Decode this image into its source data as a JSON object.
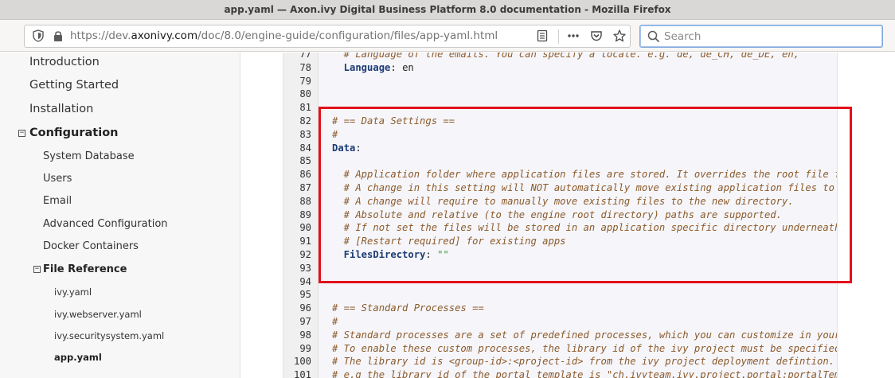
{
  "window": {
    "title": "app.yaml — Axon.ivy Digital Business Platform 8.0 documentation - Mozilla Firefox"
  },
  "browser": {
    "url_scheme": "https://dev.",
    "url_domain": "axonivy.com",
    "url_path": "/doc/8.0/engine-guide/configuration/files/app-yaml.html",
    "search_placeholder": "Search",
    "icons": [
      "shield-icon",
      "lock-icon",
      "reader-view-icon",
      "more-icon",
      "pocket-icon",
      "star-icon",
      "search-icon"
    ]
  },
  "sidebar": {
    "items": [
      {
        "label": "Introduction",
        "level": 1
      },
      {
        "label": "Getting Started",
        "level": 1
      },
      {
        "label": "Installation",
        "level": 1
      },
      {
        "label": "Configuration",
        "level": 1,
        "expanded": true
      },
      {
        "label": "System Database",
        "level": 2
      },
      {
        "label": "Users",
        "level": 2
      },
      {
        "label": "Email",
        "level": 2
      },
      {
        "label": "Advanced Configuration",
        "level": 2
      },
      {
        "label": "Docker Containers",
        "level": 2
      },
      {
        "label": "File Reference",
        "level": 2,
        "expanded": true
      },
      {
        "label": "ivy.yaml",
        "level": 3
      },
      {
        "label": "ivy.webserver.yaml",
        "level": 3
      },
      {
        "label": "ivy.securitysystem.yaml",
        "level": 3
      },
      {
        "label": "app.yaml",
        "level": 3,
        "current": true
      },
      {
        "label": "",
        "level": 3
      }
    ],
    "toggle_symbol": "−"
  },
  "code": {
    "lines": [
      {
        "n": "77",
        "cls": "cm",
        "text": "  # Language of the emails. You can specify a locale. e.g. de, de_CH, de_DE, en,"
      },
      {
        "n": "78",
        "cls": "kv",
        "key": "  Language",
        "sep": ": ",
        "val": "en",
        "valcls": "plain"
      },
      {
        "n": "79",
        "cls": "plain",
        "text": ""
      },
      {
        "n": "80",
        "cls": "plain",
        "text": ""
      },
      {
        "n": "81",
        "cls": "plain",
        "text": ""
      },
      {
        "n": "82",
        "cls": "cm",
        "text": "# == Data Settings =="
      },
      {
        "n": "83",
        "cls": "cm",
        "text": "#"
      },
      {
        "n": "84",
        "cls": "kv",
        "key": "Data",
        "sep": ":",
        "val": "",
        "valcls": "plain"
      },
      {
        "n": "85",
        "cls": "plain",
        "text": ""
      },
      {
        "n": "86",
        "cls": "cm",
        "text": "  # Application folder where application files are stored. It overrides the root file fo"
      },
      {
        "n": "87",
        "cls": "cm",
        "text": "  # A change in this setting will NOT automatically move existing application files to t"
      },
      {
        "n": "88",
        "cls": "cm",
        "text": "  # A change will require to manually move existing files to the new directory."
      },
      {
        "n": "89",
        "cls": "cm",
        "text": "  # Absolute and relative (to the engine root directory) paths are supported."
      },
      {
        "n": "90",
        "cls": "cm",
        "text": "  # If not set the files will be stored in an application specific directory underneath"
      },
      {
        "n": "91",
        "cls": "cm",
        "text": "  # [Restart required] for existing apps"
      },
      {
        "n": "92",
        "cls": "kv",
        "key": "  FilesDirectory",
        "sep": ": ",
        "val": "\"\"",
        "valcls": "str"
      },
      {
        "n": "93",
        "cls": "plain",
        "text": ""
      },
      {
        "n": "94",
        "cls": "plain",
        "text": ""
      },
      {
        "n": "95",
        "cls": "plain",
        "text": ""
      },
      {
        "n": "96",
        "cls": "cm",
        "text": "# == Standard Processes =="
      },
      {
        "n": "97",
        "cls": "cm",
        "text": "#"
      },
      {
        "n": "98",
        "cls": "cm",
        "text": "# Standard processes are a set of predefined processes, which you can customize in your"
      },
      {
        "n": "99",
        "cls": "cm",
        "text": "# To enable these custom processes, the library id of the ivy project must be specified"
      },
      {
        "n": "100",
        "cls": "cm",
        "text": "# The library id is <group-id>:<project-id> from the ivy project deployment defintion."
      },
      {
        "n": "101",
        "cls": "cm",
        "text": "# e.g the library id of the portal template is \"ch.ivyteam.ivy.project.portal:portalTemp"
      }
    ]
  },
  "colors": {
    "highlight": "#e2101a",
    "comment": "#8b5a2b",
    "key": "#1e3b74",
    "string": "#3a9c3a"
  }
}
